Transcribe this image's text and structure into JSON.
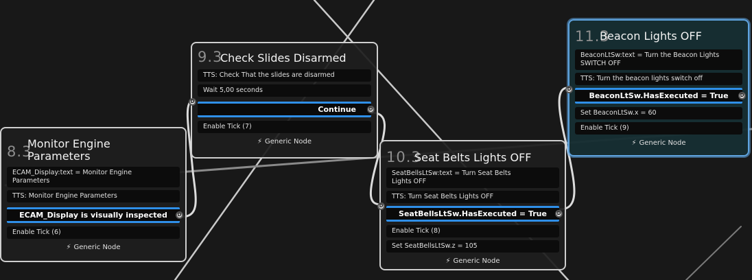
{
  "nodes": {
    "check_slides": {
      "number": "9.3",
      "title": "Check Slides Disarmed",
      "rows": [
        "TTS: Check That the slides are disarmed",
        "Wait 5,00 seconds"
      ],
      "condition": "Continue",
      "tick": "Enable Tick (7)",
      "footer": "Generic Node"
    },
    "monitor_engine": {
      "number": "8.3",
      "title_line1": "Monitor Engine",
      "title_line2": "Parameters",
      "rows": [
        "ECAM_Display:text = Monitor Engine Parameters",
        "TTS: Monitor Engine Parameters"
      ],
      "condition": "ECAM_Display is visually inspected",
      "tick": "Enable Tick (6)",
      "footer": "Generic Node"
    },
    "seat_belts": {
      "number": "10.3",
      "title": "Seat Belts Lights OFF",
      "rows": [
        "SeatBellsLtSw:text = Turn Seat Belts Lights OFF",
        "TTS: Turn Seat Belts Lights OFF"
      ],
      "condition": "SeatBellsLtSw.HasExecuted = True",
      "rows_after": [
        "Enable Tick (8)",
        "Set SeatBellsLtSw.z = 105"
      ],
      "footer": "Generic Node"
    },
    "beacon": {
      "number": "11.3",
      "title": "Beacon Lights OFF",
      "rows": [
        "BeaconLtSw:text = Turn the Beacon Lights SWITCH OFF",
        "TTS: Turn the beacon lights switch off"
      ],
      "condition": "BeaconLtSw.HasExecuted = True",
      "rows_after": [
        "Set BeaconLtSw.x = 60",
        "Enable Tick (9)"
      ],
      "footer": "Generic Node"
    }
  },
  "icons": {
    "pin": "D",
    "bolt": "⚡"
  },
  "colors": {
    "accent": "#2f8fe8",
    "selected_border": "#5fa4e0",
    "background": "#181818"
  }
}
